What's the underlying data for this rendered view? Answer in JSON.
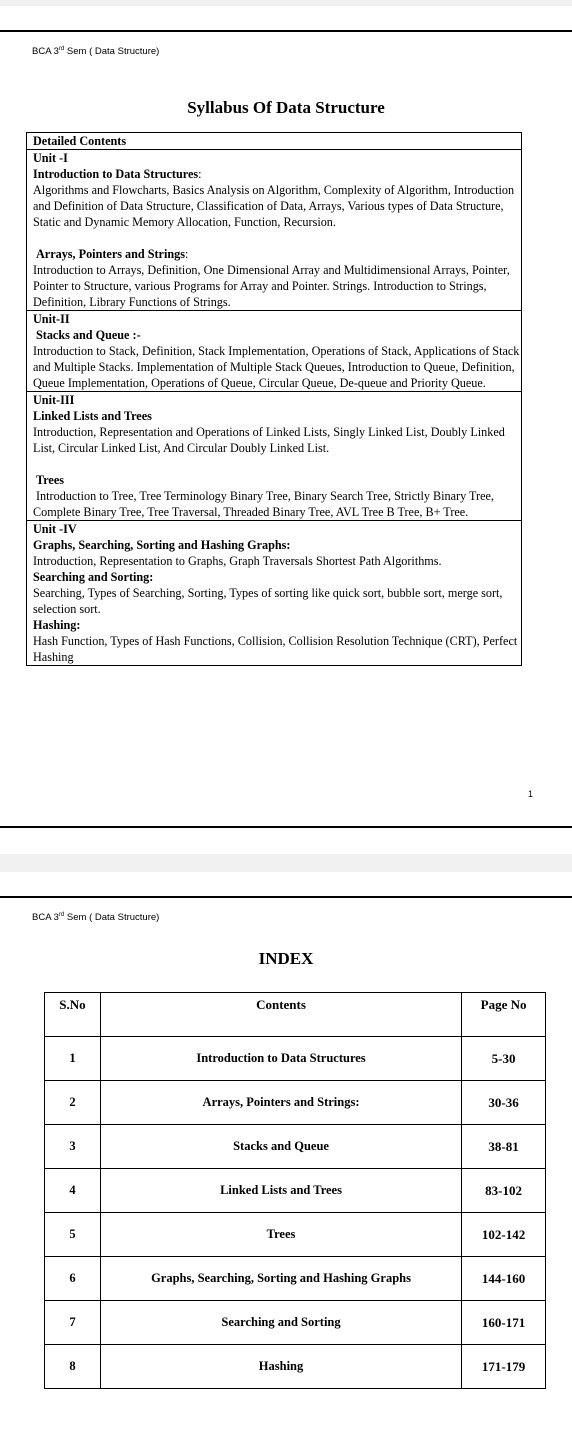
{
  "page1": {
    "header": {
      "prefix": "BCA 3",
      "sup": "rd",
      "suffix": " Sem ( Data Structure)"
    },
    "title": "Syllabus Of Data Structure",
    "detailed_label": "Detailed Contents",
    "unit1": {
      "label": "Unit -I",
      "heading1": "Introduction to Data Structures",
      "heading1_colon": ":",
      "text1": "Algorithms and Flowcharts, Basics Analysis on Algorithm, Complexity of Algorithm, Introduction and Definition of Data Structure, Classification of Data, Arrays, Various types of Data Structure, Static and Dynamic Memory Allocation, Function, Recursion.",
      "heading2": "Arrays, Pointers and Strings",
      "heading2_colon": ":",
      "text2": "Introduction to Arrays, Definition, One Dimensional Array and Multidimensional Arrays, Pointer, Pointer to Structure, various Programs for Array and Pointer. Strings. Introduction to Strings, Definition, Library Functions of Strings."
    },
    "unit2": {
      "label": "Unit-II",
      "heading": "Stacks and Queue :-",
      "text": "Introduction to Stack, Definition, Stack Implementation, Operations of Stack, Applications of Stack and Multiple Stacks. Implementation of Multiple Stack Queues, Introduction to Queue, Definition, Queue Implementation, Operations of Queue, Circular Queue, De-queue and Priority Queue."
    },
    "unit3": {
      "label": "Unit-III",
      "heading1": "Linked Lists and Trees",
      "text1": "Introduction, Representation and Operations of Linked Lists, Singly Linked List, Doubly Linked List, Circular Linked List, And Circular Doubly Linked List.",
      "heading2": "Trees",
      "text2": "Introduction to Tree, Tree Terminology Binary Tree, Binary Search Tree, Strictly Binary Tree, Complete Binary Tree, Tree Traversal, Threaded Binary Tree, AVL Tree B Tree, B+ Tree."
    },
    "unit4": {
      "label": "Unit -IV",
      "heading1": "Graphs, Searching, Sorting and Hashing Graphs:",
      "text1": "Introduction, Representation to Graphs, Graph Traversals Shortest Path Algorithms.",
      "heading2": "Searching and Sorting:",
      "text2": "Searching, Types of Searching, Sorting, Types of sorting like quick sort, bubble sort, merge sort, selection sort.",
      "heading3": "Hashing:",
      "text3": "Hash Function, Types of Hash Functions, Collision, Collision Resolution Technique (CRT), Perfect Hashing"
    },
    "page_number": "1"
  },
  "page2": {
    "header": {
      "prefix": "BCA 3",
      "sup": "rd",
      "suffix": " Sem ( Data Structure)"
    },
    "title": "INDEX",
    "columns": [
      "S.No",
      "Contents",
      "Page No"
    ],
    "rows": [
      {
        "sno": "1",
        "content": "Introduction to Data Structures",
        "page": "5-30"
      },
      {
        "sno": "2",
        "content": "Arrays, Pointers and Strings:",
        "page": "30-36"
      },
      {
        "sno": "3",
        "content": "Stacks and Queue",
        "page": "38-81"
      },
      {
        "sno": "4",
        "content": "Linked Lists and Trees",
        "page": "83-102"
      },
      {
        "sno": "5",
        "content": "Trees",
        "page": "102-142"
      },
      {
        "sno": "6",
        "content": "Graphs, Searching, Sorting and Hashing Graphs",
        "page": "144-160"
      },
      {
        "sno": "7",
        "content": "Searching and Sorting",
        "page": "160-171"
      },
      {
        "sno": "8",
        "content": "Hashing",
        "page": "171-179"
      }
    ]
  }
}
